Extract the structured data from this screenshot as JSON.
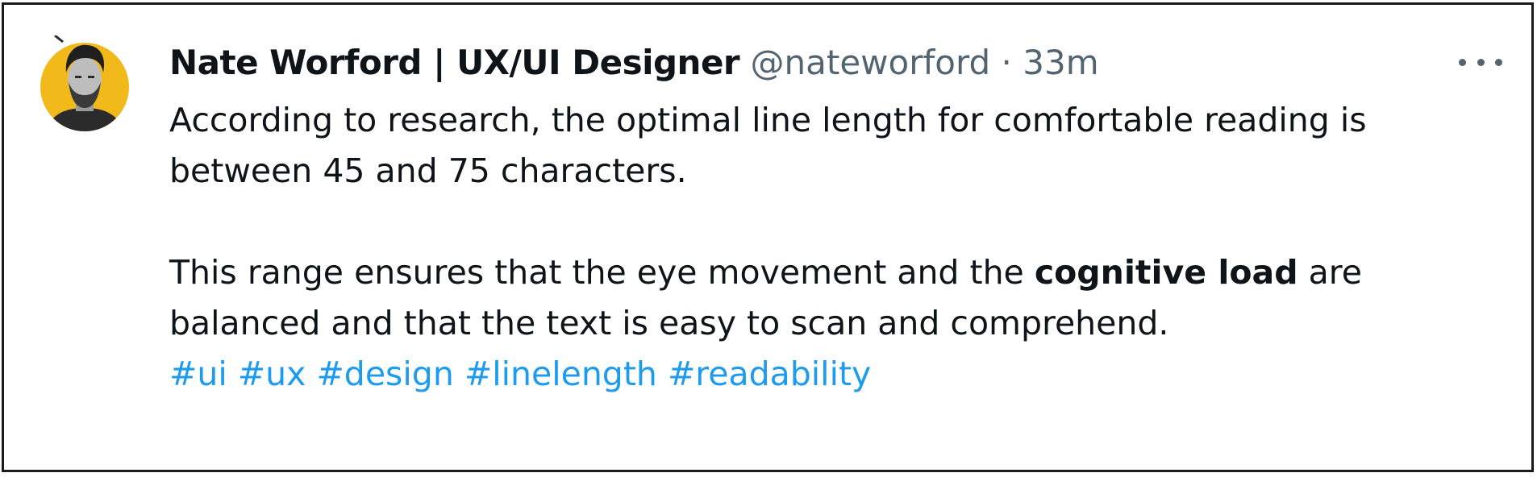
{
  "tweet": {
    "author": {
      "name": "Nate Worford | UX/UI Designer",
      "handle": "@nateworford",
      "separator": "·",
      "time": "33m"
    },
    "more_icon": "more-horizontal-icon",
    "paragraph1": {
      "line1": "According to research, the optimal line length for comfortable reading is",
      "line2": "between 45 and 75 characters."
    },
    "paragraph2": {
      "before_bold": "This range ensures that the eye movement and the ",
      "bold": "cognitive load",
      "after_bold": " are",
      "line2": "balanced and that the text is easy to scan and comprehend."
    },
    "hashtags": [
      "#ui",
      "#ux",
      "#design",
      "#linelength",
      "#readability"
    ]
  },
  "colors": {
    "text": "#0f1419",
    "meta": "#536471",
    "link": "#1d9bf0",
    "avatar_ring": "#f2b91b"
  }
}
